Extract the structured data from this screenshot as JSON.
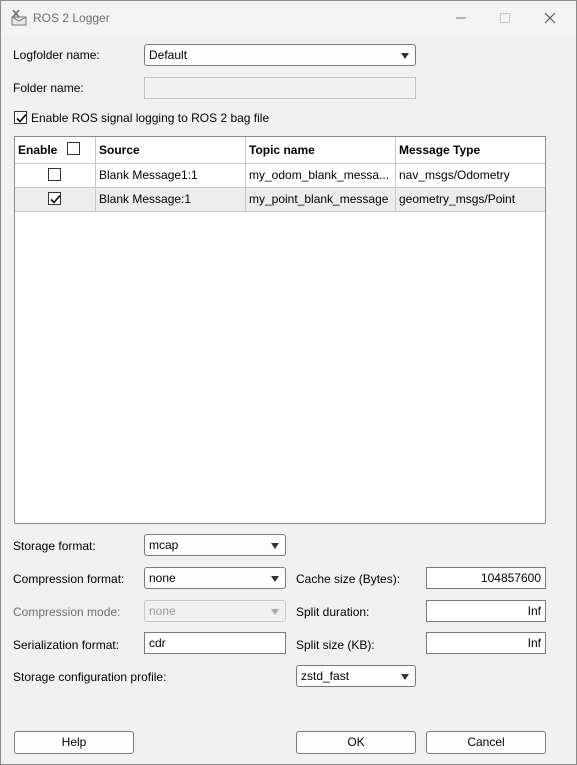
{
  "window": {
    "title": "ROS 2 Logger"
  },
  "logfolder": {
    "label": "Logfolder name:",
    "value": "Default"
  },
  "folder": {
    "label": "Folder name:",
    "value": ""
  },
  "enable_logging": {
    "label": "Enable ROS signal logging to ROS 2 bag file",
    "checked": true
  },
  "table": {
    "headers": {
      "enable": "Enable",
      "source": "Source",
      "topic": "Topic name",
      "message_type": "Message Type"
    },
    "rows": [
      {
        "checked": false,
        "source": "Blank Message1:1",
        "topic": "my_odom_blank_messa...",
        "message_type": "nav_msgs/Odometry"
      },
      {
        "checked": true,
        "source": "Blank Message:1",
        "topic": "my_point_blank_message",
        "message_type": "geometry_msgs/Point"
      }
    ]
  },
  "storage_format": {
    "label": "Storage format:",
    "value": "mcap"
  },
  "compression_format": {
    "label": "Compression format:",
    "value": "none"
  },
  "compression_mode": {
    "label": "Compression mode:",
    "value": "none"
  },
  "serialization_format": {
    "label": "Serialization format:",
    "value": "cdr"
  },
  "storage_profile": {
    "label": "Storage configuration profile:",
    "value": "zstd_fast"
  },
  "cache_size": {
    "label": "Cache size (Bytes):",
    "value": "104857600"
  },
  "split_duration": {
    "label": "Split duration:",
    "value": "Inf"
  },
  "split_size": {
    "label": "Split size (KB):",
    "value": "Inf"
  },
  "buttons": {
    "help": "Help",
    "ok": "OK",
    "cancel": "Cancel"
  },
  "icons": {
    "app": "logger-icon",
    "minimize": "minimize-icon",
    "maximize": "maximize-icon",
    "close": "close-icon"
  }
}
